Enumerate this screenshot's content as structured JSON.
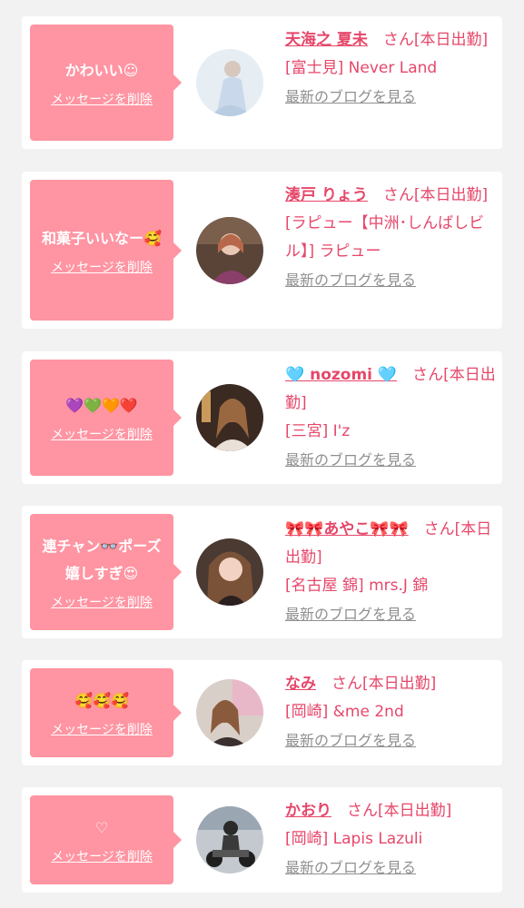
{
  "common": {
    "delete_label": "メッセージを削除",
    "blog_label": "最新のブログを見る",
    "honorific": "さん"
  },
  "colors": {
    "page_background": "#f2f2f2",
    "card_background": "#ffffff",
    "bubble": "#ff94a2",
    "accent_text": "#e6476a",
    "link_gray": "#8f8f8f"
  },
  "cards": [
    {
      "message": "かわいい☺",
      "name": "天海之 夏未",
      "status": "[本日出勤]",
      "shop": "[富士見] Never Land"
    },
    {
      "message": "和菓子いいなー🥰",
      "name": "湊戸 りょう",
      "status": "[本日出勤]",
      "shop": "[ラピュー【中洲･しんばしビル】] ラピュー"
    },
    {
      "message": "💜💚🧡❤️",
      "name": "🩵 nozomi 🩵",
      "status": "[本日出勤]",
      "shop": "[三宮] I'z"
    },
    {
      "message_line1": "連チャン👓ポーズ",
      "message_line2": "嬉しすぎ😍",
      "name": "🎀🎀あやこ🎀🎀",
      "status": "[本日出勤]",
      "shop": "[名古屋 錦] mrs.J 錦"
    },
    {
      "message": "🥰🥰🥰",
      "name": "なみ",
      "status": "[本日出勤]",
      "shop": "[岡崎] &me 2nd"
    },
    {
      "message": "♡",
      "name": "かおり",
      "status": "[本日出勤]",
      "shop": "[岡崎] Lapis Lazuli"
    }
  ]
}
